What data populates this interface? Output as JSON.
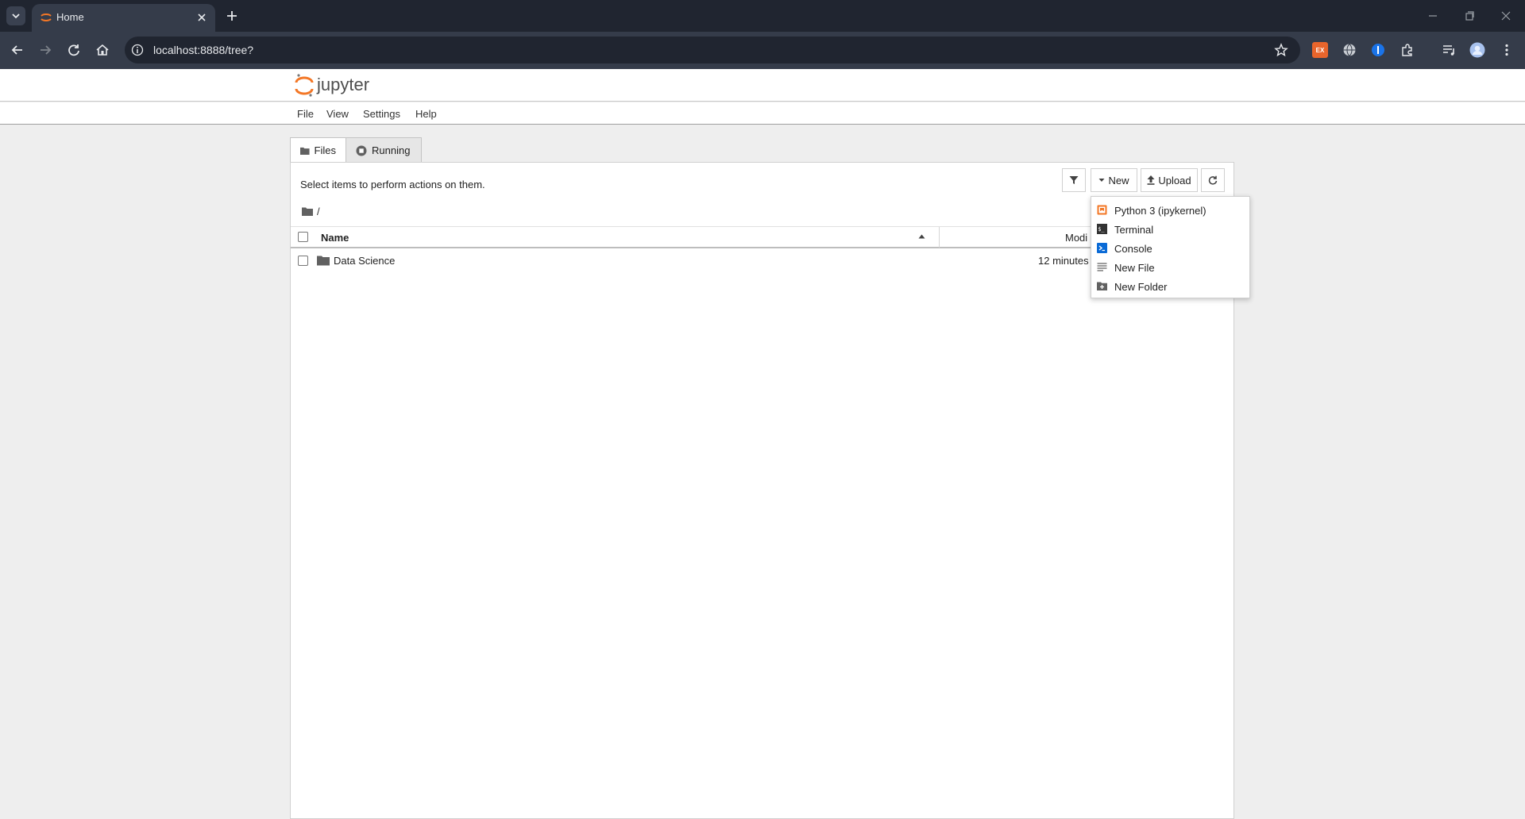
{
  "browser": {
    "tab_title": "Home",
    "url": "localhost:8888/tree?",
    "extension_badge": "EX"
  },
  "jupyter": {
    "brand": "jupyter",
    "menu": [
      "File",
      "View",
      "Settings",
      "Help"
    ],
    "tabs": [
      {
        "label": "Files",
        "icon": "folder-icon",
        "active": true
      },
      {
        "label": "Running",
        "icon": "stop-circle-icon",
        "active": false
      }
    ],
    "hint": "Select items to perform actions on them.",
    "toolbar": {
      "new_label": "New",
      "upload_label": "Upload"
    },
    "breadcrumb": "/",
    "list": {
      "header_name": "Name",
      "header_modified": "Modi",
      "rows": [
        {
          "name": "Data Science",
          "type": "folder",
          "modified": "12 minutes"
        }
      ]
    },
    "new_menu": [
      {
        "label": "Python 3 (ipykernel)",
        "icon": "python-notebook-icon"
      },
      {
        "label": "Terminal",
        "icon": "terminal-icon"
      },
      {
        "label": "Console",
        "icon": "console-icon"
      },
      {
        "label": "New File",
        "icon": "text-file-icon"
      },
      {
        "label": "New Folder",
        "icon": "new-folder-icon"
      }
    ]
  },
  "colors": {
    "chrome_dark": "#202530",
    "chrome_toolbar": "#353c4a",
    "jupyter_orange": "#f37726",
    "console_blue": "#0a6ad6"
  }
}
